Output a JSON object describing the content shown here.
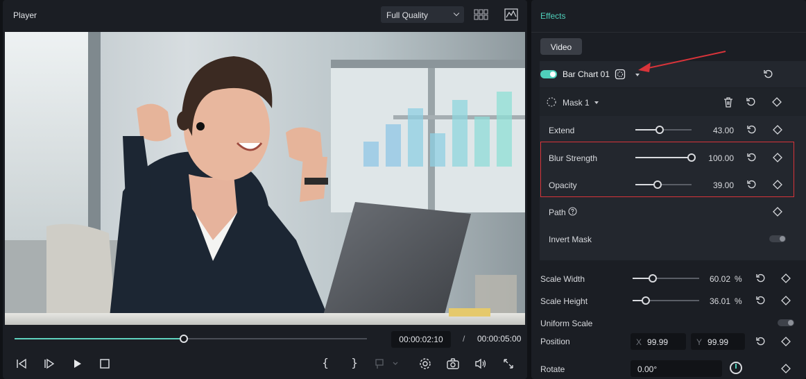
{
  "player": {
    "title": "Player",
    "quality": "Full Quality",
    "scrub_progress": 0.48,
    "current_time": "00:00:02:10",
    "separator": "/",
    "total_time": "00:00:05:00",
    "controls": [
      "prev-frame",
      "next-frame",
      "play",
      "stop",
      "mark-in",
      "mark-out",
      "marker",
      "settings",
      "snapshot",
      "volume",
      "fullscreen"
    ]
  },
  "effects": {
    "title": "Effects",
    "tab": "Video",
    "layer": {
      "name": "Bar Chart 01",
      "enabled": true
    },
    "mask": {
      "name": "Mask 1",
      "extend": {
        "label": "Extend",
        "value": "43.00",
        "level": 0.43
      },
      "blur": {
        "label": "Blur Strength",
        "value": "100.00",
        "level": 1.0
      },
      "opacity": {
        "label": "Opacity",
        "value": "39.00",
        "level": 0.39
      },
      "path_label": "Path",
      "invert_label": "Invert Mask"
    },
    "scale_width": {
      "label": "Scale Width",
      "value": "60.02",
      "unit": "%",
      "level": 0.3
    },
    "scale_height": {
      "label": "Scale Height",
      "value": "36.01",
      "unit": "%",
      "level": 0.2
    },
    "uniform_label": "Uniform Scale",
    "position": {
      "label": "Position",
      "x_axis": "X",
      "x": "99.99",
      "y_axis": "Y",
      "y": "99.99"
    },
    "rotate": {
      "label": "Rotate",
      "value": "0.00°"
    }
  },
  "colors": {
    "accent": "#4fd0bb",
    "highlight": "#d9343a",
    "panel": "#1b1e24"
  }
}
